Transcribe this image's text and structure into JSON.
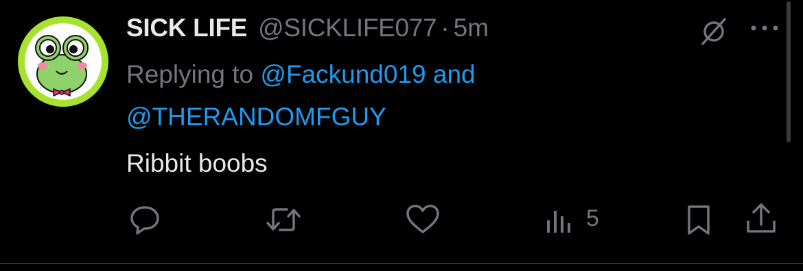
{
  "tweet": {
    "author_name": "SICK LIFE",
    "author_handle": "@SICKLIFE077",
    "separator": "·",
    "timestamp": "5m",
    "replying_prefix": "Replying to ",
    "reply_mention_1": "@Fackund019",
    "reply_joiner": " and ",
    "reply_mention_2": "@THERANDOMFGUY",
    "text": "Ribbit boobs",
    "views_count": "5"
  },
  "icons": {
    "avatar": "frog-avatar",
    "grok": "grok-slash-icon",
    "more": "more-dots-icon",
    "reply": "reply-icon",
    "retweet": "retweet-icon",
    "like": "heart-icon",
    "views": "views-bars-icon",
    "bookmark": "bookmark-icon",
    "share": "share-icon"
  },
  "colors": {
    "background": "#000000",
    "text_primary": "#e7e9ea",
    "text_secondary": "#71767b",
    "link": "#1d9bf0",
    "avatar_ring": "#a6e22e"
  }
}
